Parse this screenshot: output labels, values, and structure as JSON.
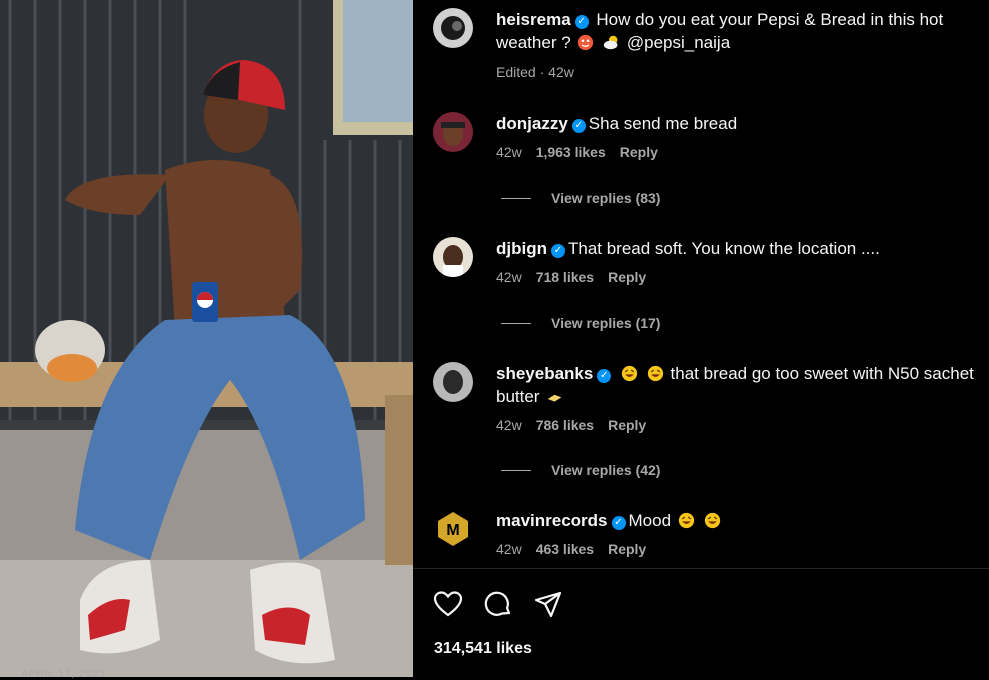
{
  "post": {
    "author": "heisrema",
    "caption": "How do you eat your Pepsi & Bread in this hot weather ?",
    "mention": "@pepsi_naija",
    "edited": "Edited",
    "age": "42w"
  },
  "comments": [
    {
      "user": "donjazzy",
      "text": "Sha send me bread",
      "age": "42w",
      "likes": "1,963 likes",
      "reply": "Reply",
      "view_replies": "View replies (83)"
    },
    {
      "user": "djbign",
      "text": "That bread soft. You know the location ....",
      "age": "42w",
      "likes": "718 likes",
      "reply": "Reply",
      "view_replies": "View replies (17)"
    },
    {
      "user": "sheyebanks",
      "text": "that bread go too sweet with N50 sachet",
      "text2": "butter",
      "age": "42w",
      "likes": "786 likes",
      "reply": "Reply",
      "view_replies": "View replies (42)"
    },
    {
      "user": "mavinrecords",
      "text": "Mood",
      "age": "42w",
      "likes": "463 likes",
      "reply": "Reply"
    }
  ],
  "footer": {
    "likes": "314,541 likes",
    "date": "APRIL 17, 2023"
  },
  "icons": {
    "like": "heart-icon",
    "comment": "comment-icon",
    "share": "share-icon",
    "verified": "verified-badge-icon"
  },
  "colors": {
    "accent": "#0095f6",
    "muted": "#a8a8a8"
  }
}
